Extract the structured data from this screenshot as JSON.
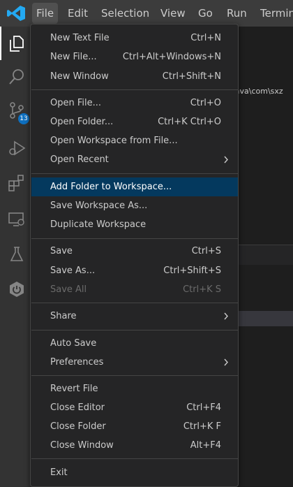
{
  "menubar": {
    "items": [
      "File",
      "Edit",
      "Selection",
      "View",
      "Go",
      "Run",
      "Termin"
    ],
    "active": "File"
  },
  "activity_bar": {
    "icons": [
      "explorer-icon",
      "search-icon",
      "source-control-icon",
      "run-debug-icon",
      "extensions-icon",
      "remote-explorer-icon",
      "testing-icon",
      "spring-boot-icon"
    ],
    "source_control_badge": "13"
  },
  "background": {
    "path_fragment": "\\java\\com\\sxz"
  },
  "file_menu": {
    "items": [
      {
        "label": "New Text File",
        "shortcut": "Ctrl+N"
      },
      {
        "label": "New File...",
        "shortcut": "Ctrl+Alt+Windows+N"
      },
      {
        "label": "New Window",
        "shortcut": "Ctrl+Shift+N"
      },
      {
        "label": "Open File...",
        "shortcut": "Ctrl+O"
      },
      {
        "label": "Open Folder...",
        "shortcut": "Ctrl+K Ctrl+O"
      },
      {
        "label": "Open Workspace from File...",
        "shortcut": ""
      },
      {
        "label": "Open Recent",
        "shortcut": ""
      },
      {
        "label": "Add Folder to Workspace...",
        "shortcut": ""
      },
      {
        "label": "Save Workspace As...",
        "shortcut": ""
      },
      {
        "label": "Duplicate Workspace",
        "shortcut": ""
      },
      {
        "label": "Save",
        "shortcut": "Ctrl+S"
      },
      {
        "label": "Save As...",
        "shortcut": "Ctrl+Shift+S"
      },
      {
        "label": "Save All",
        "shortcut": "Ctrl+K S"
      },
      {
        "label": "Share",
        "shortcut": ""
      },
      {
        "label": "Auto Save",
        "shortcut": ""
      },
      {
        "label": "Preferences",
        "shortcut": ""
      },
      {
        "label": "Revert File",
        "shortcut": ""
      },
      {
        "label": "Close Editor",
        "shortcut": "Ctrl+F4"
      },
      {
        "label": "Close Folder",
        "shortcut": "Ctrl+K F"
      },
      {
        "label": "Close Window",
        "shortcut": "Alt+F4"
      },
      {
        "label": "Exit",
        "shortcut": ""
      }
    ],
    "highlighted": "Add Folder to Workspace...",
    "disabled": [
      "Save All"
    ],
    "submenus": [
      "Open Recent",
      "Share",
      "Preferences"
    ]
  },
  "colors": {
    "highlight": "#04395e",
    "accent": "#0e70c0",
    "menu_bg": "#252526"
  }
}
